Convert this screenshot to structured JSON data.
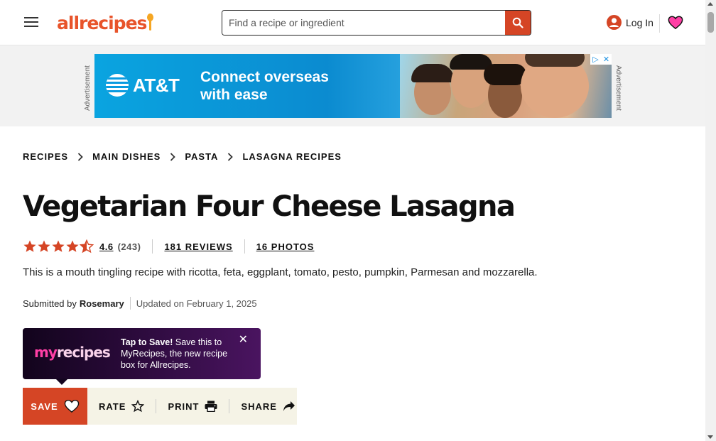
{
  "header": {
    "logo_text": "allrecipes",
    "search_placeholder": "Find a recipe or ingredient",
    "login_label": "Log In"
  },
  "ad": {
    "label": "Advertisement",
    "brand": "AT&T",
    "headline_line1": "Connect overseas",
    "headline_line2": "with ease",
    "ad_choices_icon": "ad-choices-icon",
    "close_icon": "close-icon"
  },
  "breadcrumb": {
    "items": [
      "RECIPES",
      "MAIN DISHES",
      "PASTA",
      "LASAGNA RECIPES"
    ]
  },
  "recipe": {
    "title": "Vegetarian Four Cheese Lasagna",
    "rating_value": "4.6",
    "rating_count": "(243)",
    "reviews_link": "181 REVIEWS",
    "photos_link": "16 PHOTOS",
    "description": "This is a mouth tingling recipe with ricotta, feta, eggplant, tomato, pesto, pumpkin, Parmesan and mozzarella.",
    "submitted_prefix": "Submitted by",
    "author": "Rosemary",
    "updated": "Updated on February 1, 2025"
  },
  "promo": {
    "logo_my": "my",
    "logo_recipes": "recipes",
    "tap_to_save": "Tap to Save!",
    "body": " Save this to MyRecipes, the new recipe box for Allrecipes."
  },
  "actions": {
    "save": "SAVE",
    "rate": "RATE",
    "print": "PRINT",
    "share": "SHARE"
  },
  "colors": {
    "brand_orange": "#e8542b",
    "button_red": "#d54525",
    "star_color": "#d54525",
    "heart_pink": "#ff3fa5",
    "action_bar_bg": "#f5f3e6"
  }
}
